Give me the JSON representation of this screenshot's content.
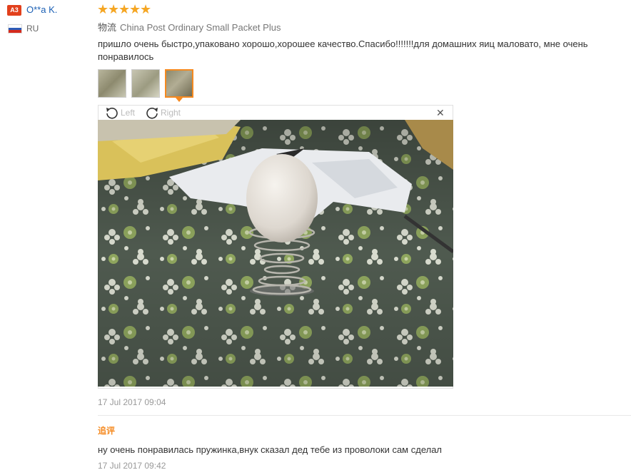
{
  "reviewer": {
    "level": "A3",
    "name": "O**a K.",
    "country": "RU",
    "flag_colors": [
      "#ffffff",
      "#2c5bb8",
      "#d52b1e"
    ]
  },
  "rating": {
    "stars": 5,
    "star_glyph": "★"
  },
  "logistics": {
    "label": "物流",
    "value": "China Post Ordinary Small Packet Plus"
  },
  "review": {
    "text": "пришло очень быстро,упаковано хорошо,хорошее качество.Спасибо!!!!!!!для домашних яиц маловато, мне очень понравилось",
    "date": "17 Jul 2017 09:04"
  },
  "photo_viewer": {
    "rotate_left_label": "Left",
    "rotate_right_label": "Right",
    "close_glyph": "✕",
    "selected_thumbnail": 3,
    "thumbnail_count": 3
  },
  "followup": {
    "label": "追评",
    "text": "ну очень понравилась пружинка,внук сказал дед тебе из проволоки сам сделал",
    "date": "17 Jul 2017 09:42"
  },
  "colors": {
    "accent": "#f5891f",
    "star": "#f5a623",
    "link": "#1a5fb4",
    "badge": "#e2401c"
  }
}
